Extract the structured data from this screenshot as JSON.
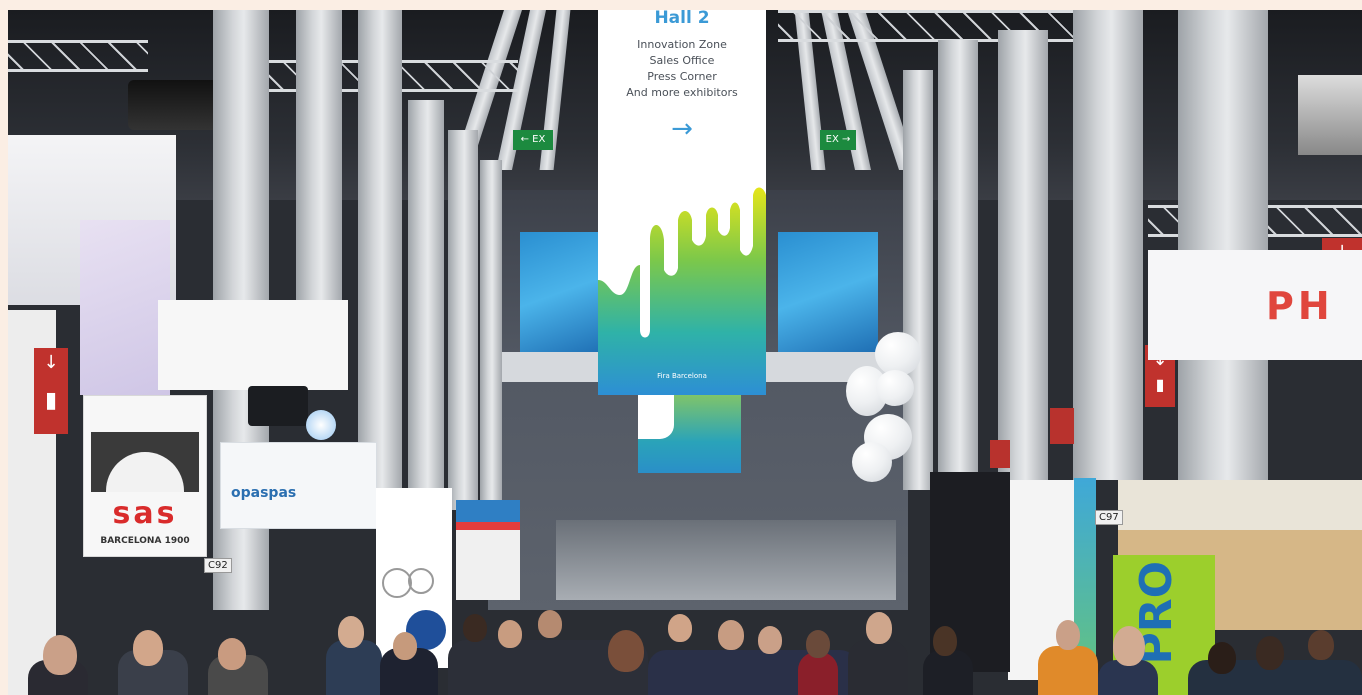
{
  "scene": "Trade show exhibition hall with hanging banner and crowd of visitors",
  "banner": {
    "title": "Hall 2",
    "lines": [
      "Innovation Zone",
      "Sales Office",
      "Press Corner",
      "And more exhibitors"
    ],
    "arrow": "→",
    "brand": "Fira Barcelona"
  },
  "booths": {
    "sas_logo": "sas",
    "sas_sub": "BARCELONA 1900",
    "sas_code": "C92",
    "spa_logo": "opaspas",
    "pro_logo": "PRO",
    "right_code": "C97",
    "right_logo": "PH"
  },
  "exit_signs": {
    "left": "← EX",
    "right": "EX →"
  },
  "colors": {
    "banner_blue": "#3b9ad6",
    "sas_red": "#d92b2b",
    "pro_green": "#9ccf2c",
    "exit_red": "#c0322d"
  }
}
